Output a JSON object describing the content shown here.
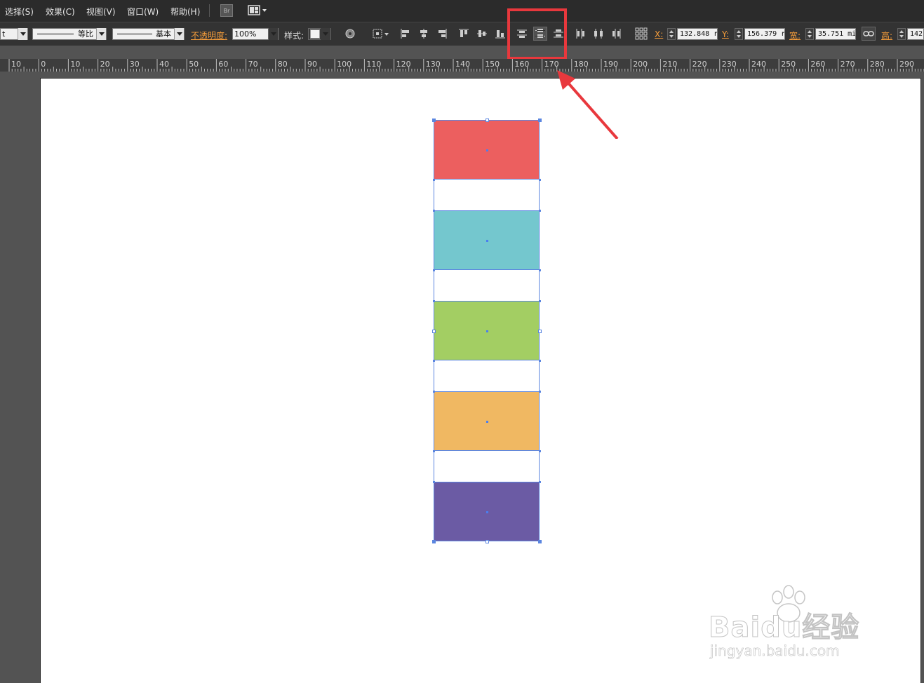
{
  "menu": {
    "items": [
      {
        "label": "选择(S)"
      },
      {
        "label": "效果(C)"
      },
      {
        "label": "视图(V)"
      },
      {
        "label": "窗口(W)"
      },
      {
        "label": "帮助(H)"
      }
    ],
    "bridge_label": "Br"
  },
  "control": {
    "unit_fragment": "t",
    "stroke_profile": "等比",
    "brush_definition": "基本",
    "opacity_label": "不透明度:",
    "opacity_value": "100%",
    "style_label": "样式:",
    "x_label": "X:",
    "x_value": "132.848 r",
    "y_label": "Y:",
    "y_value": "156.379 r",
    "w_label": "宽:",
    "w_value": "35.751 mi",
    "h_label": "高:",
    "h_value": "142"
  },
  "ruler": {
    "ticks": [
      "10",
      "0",
      "10",
      "20",
      "30",
      "40",
      "50",
      "60",
      "70",
      "80",
      "90",
      "100",
      "110",
      "120",
      "130",
      "140",
      "150",
      "160",
      "170",
      "180",
      "190",
      "200",
      "210",
      "220",
      "230",
      "240",
      "250",
      "260",
      "270",
      "280",
      "290"
    ]
  },
  "document": {
    "rectangles": [
      {
        "name": "red",
        "color": "#ec5f5f"
      },
      {
        "name": "teal",
        "color": "#74c7ce"
      },
      {
        "name": "green",
        "color": "#a3ce63"
      },
      {
        "name": "orange",
        "color": "#f0b862"
      },
      {
        "name": "purple",
        "color": "#6b5ba4"
      }
    ],
    "selection_color": "#5b86e0"
  },
  "annotation": {
    "color": "#e8383d"
  },
  "watermark": {
    "brand": "Baidu经验",
    "url": "jingyan.baidu.com"
  }
}
